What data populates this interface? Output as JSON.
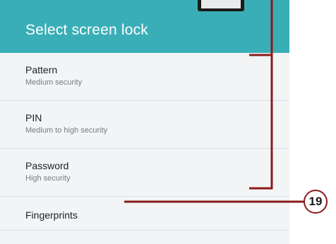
{
  "header": {
    "title": "Select screen lock"
  },
  "options": [
    {
      "title": "Pattern",
      "subtitle": "Medium security"
    },
    {
      "title": "PIN",
      "subtitle": "Medium to high security"
    },
    {
      "title": "Password",
      "subtitle": "High security"
    },
    {
      "title": "Fingerprints"
    }
  ],
  "callout": {
    "number": "19"
  },
  "colors": {
    "header": "#3aaeb6",
    "annotation": "#8b1a1a",
    "background": "#f2f4f5"
  }
}
